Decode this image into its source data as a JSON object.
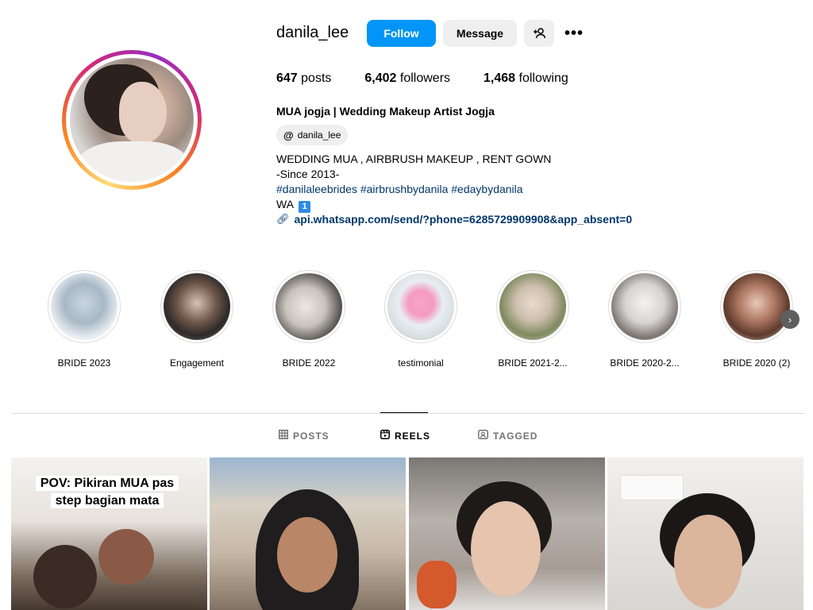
{
  "profile": {
    "username": "danila_lee",
    "full_name": "MUA jogja | Wedding Makeup Artist Jogja",
    "threads_handle": "danila_lee",
    "follow_label": "Follow",
    "message_label": "Message",
    "add_user_icon": "+♀",
    "more_label": "•••"
  },
  "stats": {
    "posts_count": "647",
    "posts_label": " posts",
    "followers_count": "6,402",
    "followers_label": " followers",
    "following_count": "1,468",
    "following_label": " following"
  },
  "bio": {
    "line1": "WEDDING MUA , AIRBRUSH MAKEUP , RENT GOWN",
    "line2": "-Since 2013-",
    "hashtags": "#danilaleebrides #airbrushbydanila #edaybydanila",
    "wa_label": "WA ",
    "wa_badge": "1",
    "link": "api.whatsapp.com/send/?phone=6285729909908&app_absent=0"
  },
  "highlights": [
    {
      "label": "BRIDE 2023"
    },
    {
      "label": "Engagement"
    },
    {
      "label": "BRIDE 2022"
    },
    {
      "label": "testimonial"
    },
    {
      "label": "BRIDE 2021-2..."
    },
    {
      "label": "BRIDE 2020-2..."
    },
    {
      "label": "BRIDE 2020 (2)"
    }
  ],
  "tabs": {
    "posts": "POSTS",
    "reels": "REELS",
    "tagged": "TAGGED",
    "active": "reels"
  },
  "reels": [
    {
      "caption_line1": "POV: Pikiran MUA pas",
      "caption_line2": "step bagian mata"
    },
    {},
    {},
    {}
  ],
  "colors": {
    "follow_button": "#0095f6",
    "link": "#00376b",
    "secondary_button": "#efefef"
  }
}
